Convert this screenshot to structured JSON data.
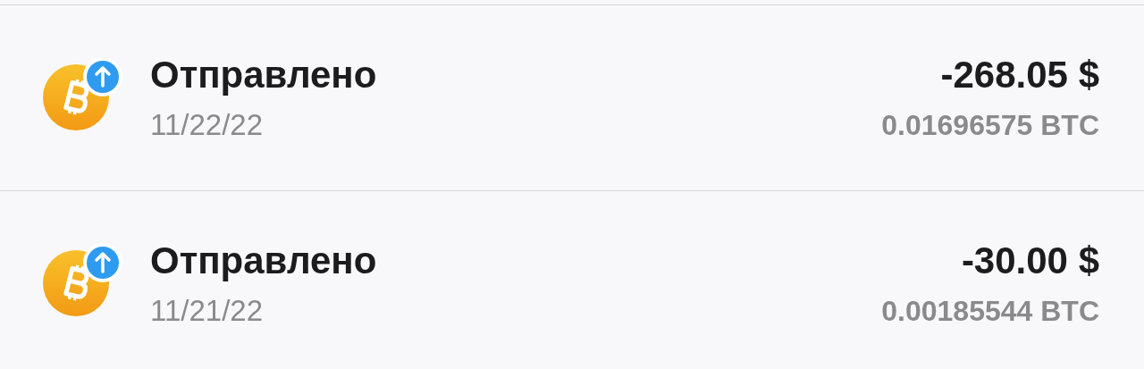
{
  "transactions": [
    {
      "title": "Отправлено",
      "date": "11/22/22",
      "amount": "-268.05 $",
      "crypto_amount": "0.01696575 BTC"
    },
    {
      "title": "Отправлено",
      "date": "11/21/22",
      "amount": "-30.00 $",
      "crypto_amount": "0.00185544 BTC"
    }
  ]
}
